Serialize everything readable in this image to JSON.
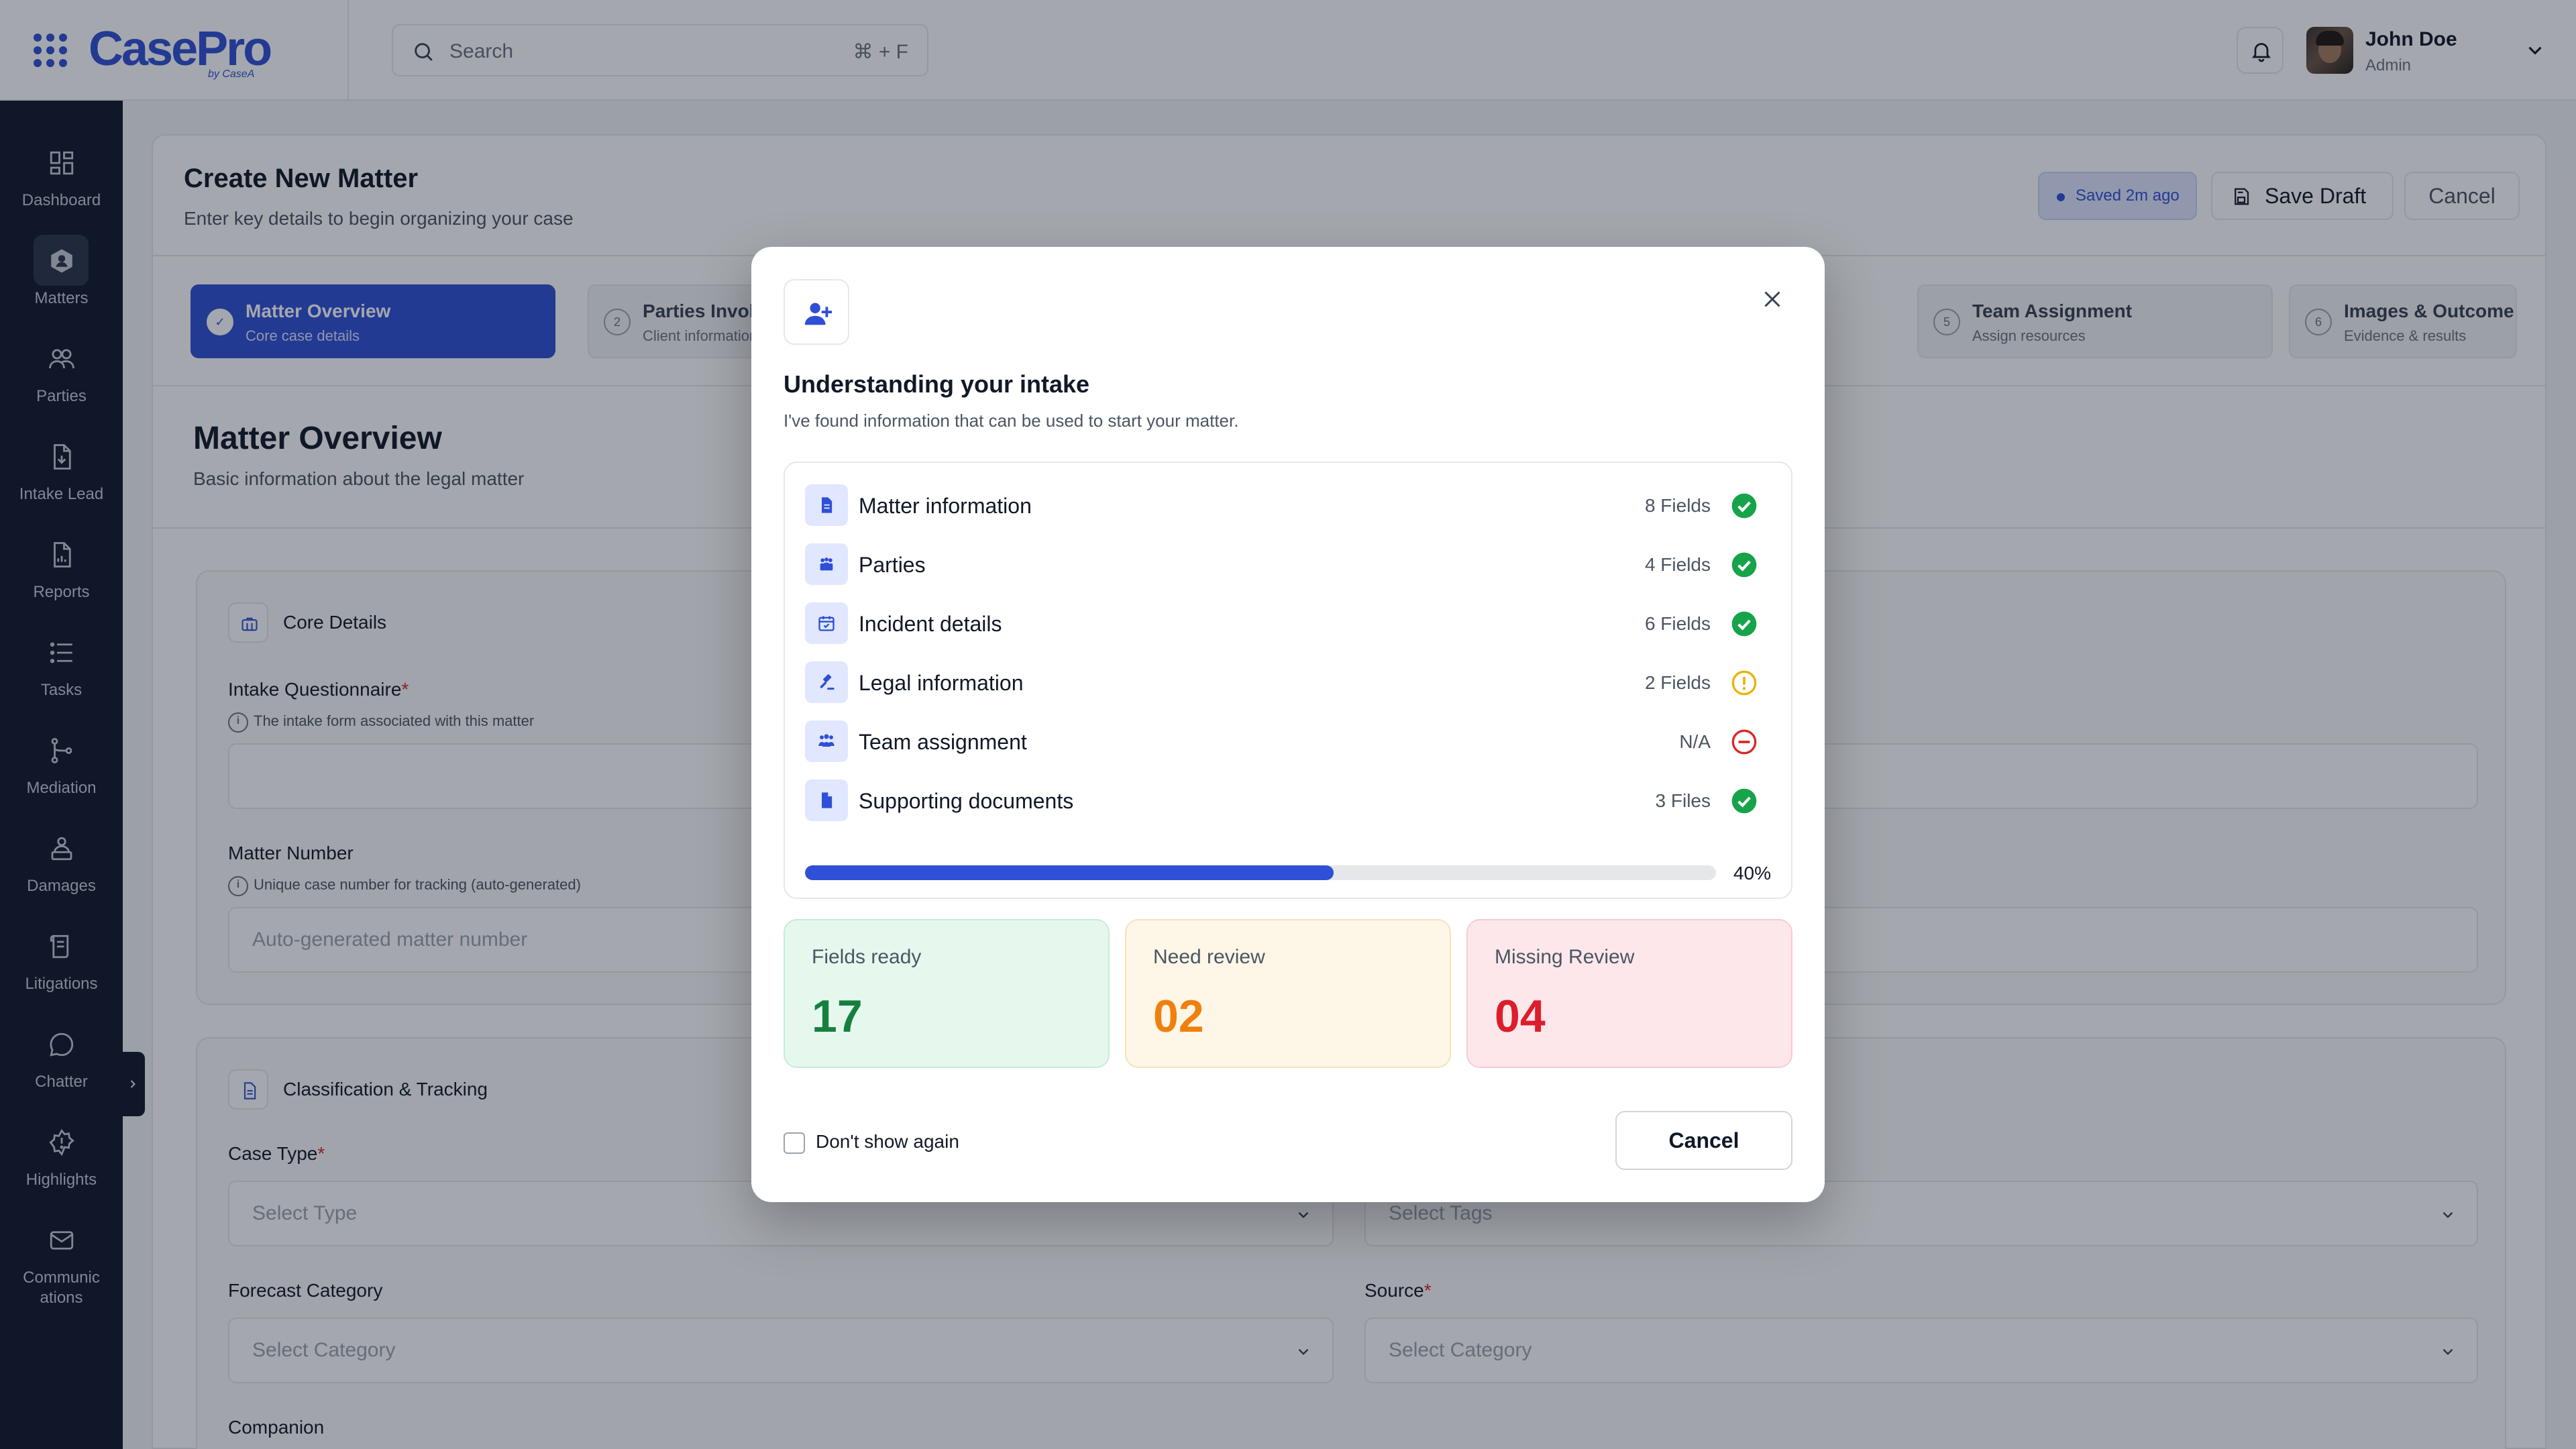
{
  "app": {
    "logo": "CasePro",
    "logo_sub": "by CaseA",
    "search_placeholder": "Search",
    "search_shortcut": "⌘ + F",
    "user": {
      "name": "John Doe",
      "role": "Admin"
    }
  },
  "sidebar": {
    "items": [
      {
        "label": "Dashboard",
        "icon": "dashboard-icon"
      },
      {
        "label": "Matters",
        "icon": "matters-icon",
        "active": true
      },
      {
        "label": "Parties",
        "icon": "parties-icon"
      },
      {
        "label": "Intake Lead",
        "icon": "intake-lead-icon"
      },
      {
        "label": "Reports",
        "icon": "reports-icon"
      },
      {
        "label": "Tasks",
        "icon": "tasks-icon"
      },
      {
        "label": "Mediation",
        "icon": "mediation-icon"
      },
      {
        "label": "Damages",
        "icon": "damages-icon"
      },
      {
        "label": "Litigations",
        "icon": "litigations-icon"
      },
      {
        "label": "Chatter",
        "icon": "chatter-icon"
      },
      {
        "label": "Highlights",
        "icon": "highlights-icon"
      },
      {
        "label": "Communic\nations",
        "icon": "communications-icon"
      }
    ]
  },
  "page": {
    "title": "Create New Matter",
    "subtitle": "Enter key details to begin organizing your case",
    "saved_badge": "Saved 2m ago",
    "save_draft": "Save Draft",
    "cancel": "Cancel"
  },
  "steps": [
    {
      "num": "✓",
      "title": "Matter Overview",
      "sub": "Core case details",
      "active": true
    },
    {
      "num": "2",
      "title": "Parties Involved",
      "sub": "Client information"
    },
    {
      "num": "5",
      "title": "Team Assignment",
      "sub": "Assign resources"
    },
    {
      "num": "6",
      "title": "Images & Outcome",
      "sub": "Evidence & results"
    }
  ],
  "section": {
    "title": "Matter Overview",
    "subtitle": "Basic information about the legal matter"
  },
  "core_details": {
    "title": "Core Details",
    "intake_label": "Intake Questionnaire",
    "intake_help": "The intake form associated with this matter",
    "matter_number_label": "Matter Number",
    "matter_number_help": "Unique case number for tracking (auto-generated)",
    "matter_number_placeholder": "Auto-generated matter number"
  },
  "classification": {
    "title": "Classification & Tracking",
    "case_type_label": "Case Type",
    "case_type_placeholder": "Select Type",
    "tags_placeholder": "Select Tags",
    "forecast_label": "Forecast Category",
    "forecast_placeholder": "Select Category",
    "source_label": "Source",
    "source_placeholder": "Select Category",
    "companion_label": "Companion"
  },
  "modal": {
    "title": "Understanding your intake",
    "subtitle": "I've found information that can be used to start your matter.",
    "rows": [
      {
        "label": "Matter information",
        "count": "8 Fields",
        "status": "ok"
      },
      {
        "label": "Parties",
        "count": "4 Fields",
        "status": "ok"
      },
      {
        "label": "Incident details",
        "count": "6 Fields",
        "status": "ok"
      },
      {
        "label": "Legal information",
        "count": "2 Fields",
        "status": "warn"
      },
      {
        "label": "Team assignment",
        "count": "N/A",
        "status": "missing"
      },
      {
        "label": "Supporting documents",
        "count": "3 Files",
        "status": "ok"
      }
    ],
    "progress_value": 0.58,
    "progress_label": "40%",
    "stats": {
      "ready_label": "Fields ready",
      "ready_value": "17",
      "review_label": "Need review",
      "review_value": "02",
      "missing_label": "Missing Review",
      "missing_value": "04"
    },
    "dont_show": "Don't show again",
    "cancel": "Cancel"
  },
  "colors": {
    "brand": "#2f4fd6",
    "ok": "#16a34a",
    "warn": "#eab308",
    "missing": "#dc2626"
  }
}
